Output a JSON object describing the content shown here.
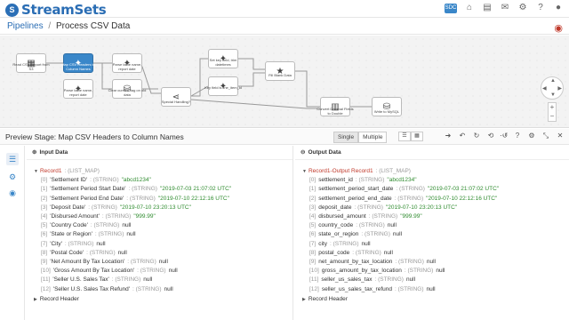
{
  "app": {
    "logo_mark": "S",
    "name": "StreamSets"
  },
  "top_icons": {
    "badge": "SDC",
    "home": "⌂",
    "store": "▤",
    "gift": "✉",
    "settings": "⚙",
    "help": "?",
    "user": "●"
  },
  "breadcrumb": {
    "root": "Pipelines",
    "separator": "/",
    "current": "Process CSV Data"
  },
  "pipeline_nodes": [
    {
      "label": "Read CSV Report from S3",
      "icon": "▦",
      "selected": false
    },
    {
      "label": "Map CSV Headers to Column Names",
      "icon": "✦",
      "selected": true
    },
    {
      "label": "Parse table name, report date",
      "icon": "✦",
      "selected": false
    },
    {
      "label": "Parse table name, report date",
      "icon": "✦",
      "selected": false
    },
    {
      "label": "Clear current flag on old data",
      "icon": "⛁",
      "selected": false
    },
    {
      "label": "Special Handling?",
      "icon": "⋖",
      "selected": false
    },
    {
      "label": "Set key field, trim datetimes",
      "icon": "✦",
      "selected": false
    },
    {
      "label": "Key field is line_item_id",
      "icon": "✦",
      "selected": false
    },
    {
      "label": "Fill Blank Data",
      "icon": "★",
      "selected": false
    },
    {
      "label": "Convert Decimal Fields to Double",
      "icon": "▥",
      "selected": false
    },
    {
      "label": "Write to MySQL",
      "icon": "⛁",
      "selected": false
    }
  ],
  "preview": {
    "title": "Preview Stage: Map CSV Headers to Column Names",
    "modes": [
      "Single",
      "Multiple"
    ],
    "active_mode": "Single"
  },
  "input": {
    "header": "Input Data",
    "record_name": "Record1",
    "record_type": ": (LIST_MAP)",
    "fields": [
      {
        "idx": "[0]",
        "name": "'Settlement ID'",
        "type": ": (STRING)",
        "value": "\"abcd1234\"",
        "kind": "str"
      },
      {
        "idx": "[1]",
        "name": "'Settlement Period Start Date'",
        "type": ": (STRING)",
        "value": "\"2019-07-03 21:07:02 UTC\"",
        "kind": "str"
      },
      {
        "idx": "[2]",
        "name": "'Settlement Period End Date'",
        "type": ": (STRING)",
        "value": "\"2019-07-10 22:12:16 UTC\"",
        "kind": "str"
      },
      {
        "idx": "[3]",
        "name": "'Deposit Date'",
        "type": ": (STRING)",
        "value": "\"2019-07-10 23:20:13 UTC\"",
        "kind": "str"
      },
      {
        "idx": "[4]",
        "name": "'Disbursed Amount'",
        "type": ": (STRING)",
        "value": "\"999.99\"",
        "kind": "str"
      },
      {
        "idx": "[5]",
        "name": "'Country Code'",
        "type": ": (STRING)",
        "value": "null",
        "kind": "nul"
      },
      {
        "idx": "[6]",
        "name": "'State or Region'",
        "type": ": (STRING)",
        "value": "null",
        "kind": "nul"
      },
      {
        "idx": "[7]",
        "name": "'City'",
        "type": ": (STRING)",
        "value": "null",
        "kind": "nul"
      },
      {
        "idx": "[8]",
        "name": "'Postal Code'",
        "type": ": (STRING)",
        "value": "null",
        "kind": "nul"
      },
      {
        "idx": "[9]",
        "name": "'Net Amount By Tax Location'",
        "type": ": (STRING)",
        "value": "null",
        "kind": "nul"
      },
      {
        "idx": "[10]",
        "name": "'Gross Amount By Tax Location'",
        "type": ": (STRING)",
        "value": "null",
        "kind": "nul"
      },
      {
        "idx": "[11]",
        "name": "'Seller U.S. Sales Tax'",
        "type": ": (STRING)",
        "value": "null",
        "kind": "nul"
      },
      {
        "idx": "[12]",
        "name": "'Seller U.S. Sales Tax Refund'",
        "type": ": (STRING)",
        "value": "null",
        "kind": "nul"
      }
    ],
    "record_header": "Record Header"
  },
  "output": {
    "header": "Output Data",
    "record_name": "Record1-Output Record1",
    "record_type": ": (LIST_MAP)",
    "fields": [
      {
        "idx": "[0]",
        "name": "settlement_id",
        "type": ": (STRING)",
        "value": "\"abcd1234\"",
        "kind": "str"
      },
      {
        "idx": "[1]",
        "name": "settlement_period_start_date",
        "type": ": (STRING)",
        "value": "\"2019-07-03 21:07:02 UTC\"",
        "kind": "str"
      },
      {
        "idx": "[2]",
        "name": "settlement_period_end_date",
        "type": ": (STRING)",
        "value": "\"2019-07-10 22:12:16 UTC\"",
        "kind": "str"
      },
      {
        "idx": "[3]",
        "name": "deposit_date",
        "type": ": (STRING)",
        "value": "\"2019-07-10 23:20:13 UTC\"",
        "kind": "str"
      },
      {
        "idx": "[4]",
        "name": "disbursed_amount",
        "type": ": (STRING)",
        "value": "\"999.99\"",
        "kind": "str"
      },
      {
        "idx": "[5]",
        "name": "country_code",
        "type": ": (STRING)",
        "value": "null",
        "kind": "nul"
      },
      {
        "idx": "[6]",
        "name": "state_or_region",
        "type": ": (STRING)",
        "value": "null",
        "kind": "nul"
      },
      {
        "idx": "[7]",
        "name": "city",
        "type": ": (STRING)",
        "value": "null",
        "kind": "nul"
      },
      {
        "idx": "[8]",
        "name": "postal_code",
        "type": ": (STRING)",
        "value": "null",
        "kind": "nul"
      },
      {
        "idx": "[9]",
        "name": "net_amount_by_tax_location",
        "type": ": (STRING)",
        "value": "null",
        "kind": "nul"
      },
      {
        "idx": "[10]",
        "name": "gross_amount_by_tax_location",
        "type": ": (STRING)",
        "value": "null",
        "kind": "nul"
      },
      {
        "idx": "[11]",
        "name": "seller_us_sales_tax",
        "type": ": (STRING)",
        "value": "null",
        "kind": "nul"
      },
      {
        "idx": "[12]",
        "name": "seller_us_sales_tax_refund",
        "type": ": (STRING)",
        "value": "null",
        "kind": "nul"
      }
    ],
    "record_header": "Record Header"
  }
}
